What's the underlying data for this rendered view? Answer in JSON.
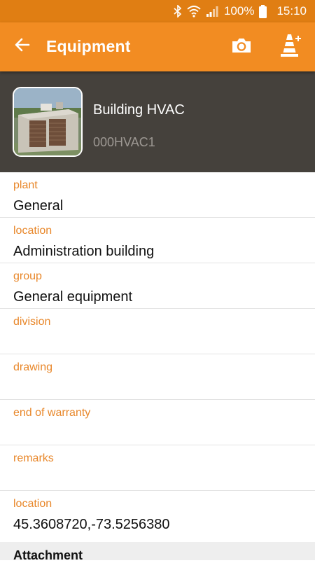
{
  "status_bar": {
    "battery_percent": "100%",
    "time": "15:10",
    "icons": [
      "bluetooth-icon",
      "wifi-icon",
      "signal-icon",
      "battery-icon"
    ]
  },
  "app_bar": {
    "title": "Equipment",
    "back_icon": "arrow-back-icon",
    "actions": [
      "camera-icon",
      "cone-add-icon"
    ],
    "color": "#f28c22"
  },
  "equipment": {
    "name": "Building HVAC",
    "code": "000HVAC1",
    "header_color": "#45413c"
  },
  "fields": [
    {
      "label": "plant",
      "value": "General"
    },
    {
      "label": "location",
      "value": "Administration building"
    },
    {
      "label": "group",
      "value": "General equipment"
    },
    {
      "label": "division",
      "value": ""
    },
    {
      "label": "drawing",
      "value": ""
    },
    {
      "label": "end of warranty",
      "value": ""
    },
    {
      "label": "remarks",
      "value": ""
    },
    {
      "label": "location",
      "value": "45.3608720,-73.5256380"
    }
  ],
  "sections": {
    "attachment_title": "Attachment"
  },
  "colors": {
    "accent": "#f28c22",
    "label": "#e8872a"
  }
}
